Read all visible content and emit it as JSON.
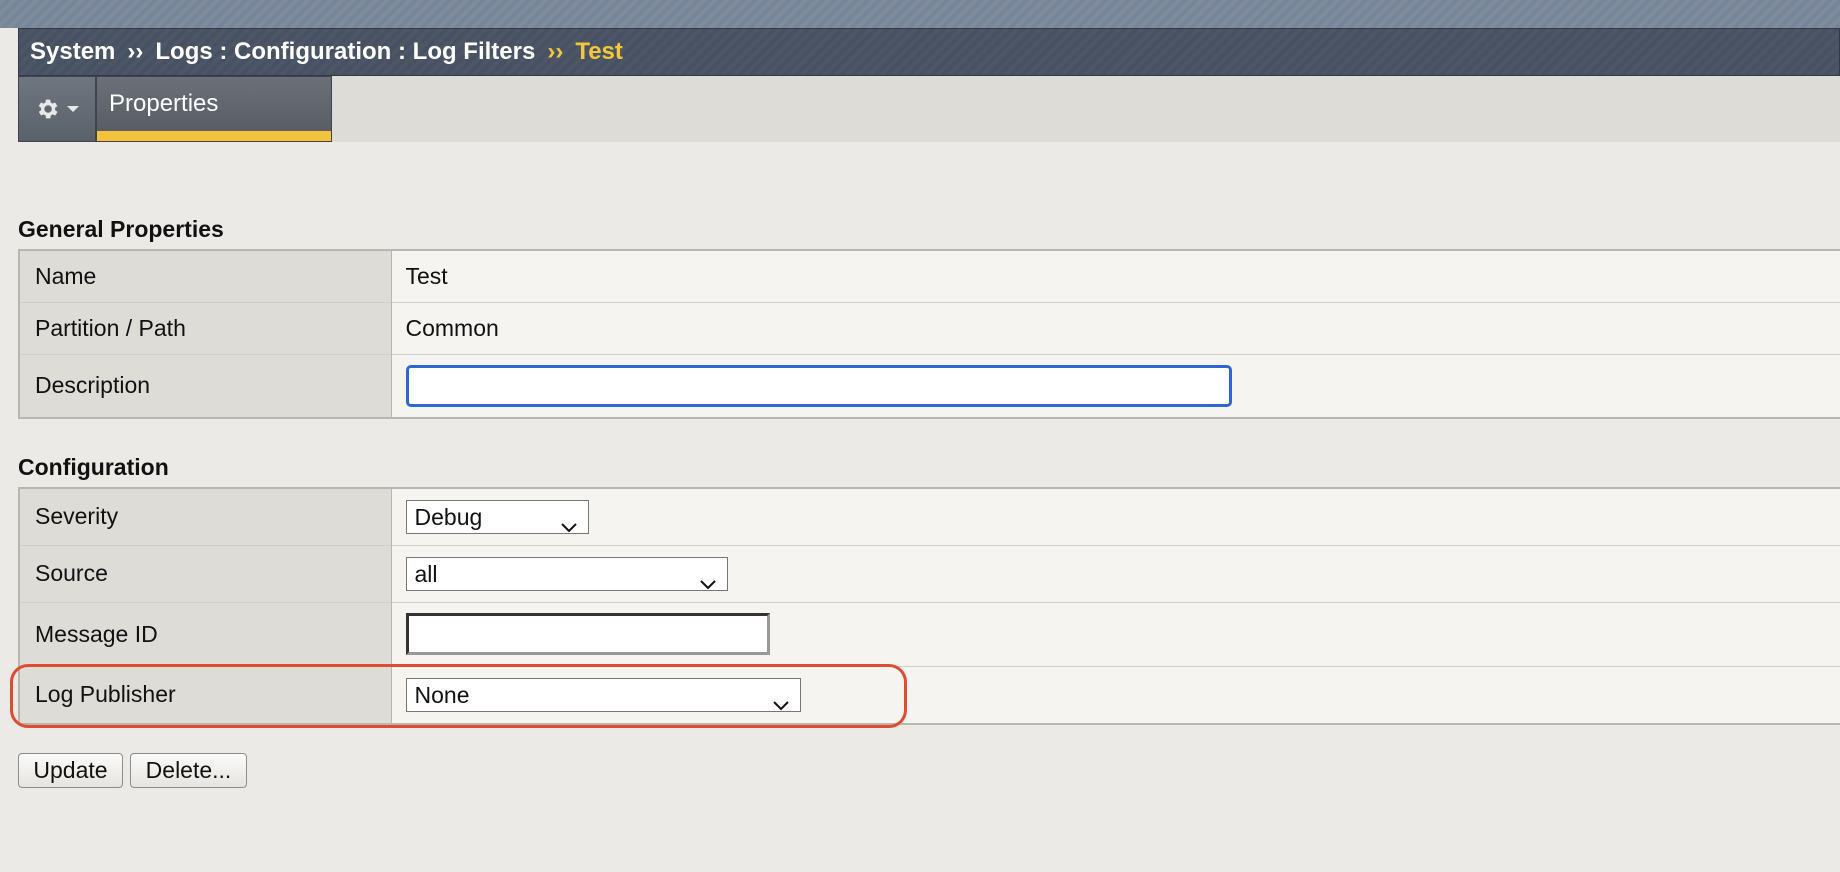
{
  "breadcrumb": {
    "items": [
      "System",
      "Logs : Configuration : Log Filters"
    ],
    "separator": "››",
    "current": "Test"
  },
  "tabs": {
    "active": "Properties"
  },
  "icons": {
    "settings": "gear-icon",
    "menu_caret": "caret-down-icon",
    "select_chevron": "chevron-down-icon"
  },
  "colors": {
    "accent": "#f3c33c",
    "focus": "#2f67d2",
    "highlight": "#e04c2f"
  },
  "general": {
    "title": "General Properties",
    "name_label": "Name",
    "name_value": "Test",
    "partition_label": "Partition / Path",
    "partition_value": "Common",
    "description_label": "Description",
    "description_value": ""
  },
  "config": {
    "title": "Configuration",
    "severity_label": "Severity",
    "severity_value": "Debug",
    "source_label": "Source",
    "source_value": "all",
    "message_id_label": "Message ID",
    "message_id_value": "",
    "log_publisher_label": "Log Publisher",
    "log_publisher_value": "None"
  },
  "actions": {
    "update_label": "Update",
    "delete_label": "Delete..."
  }
}
